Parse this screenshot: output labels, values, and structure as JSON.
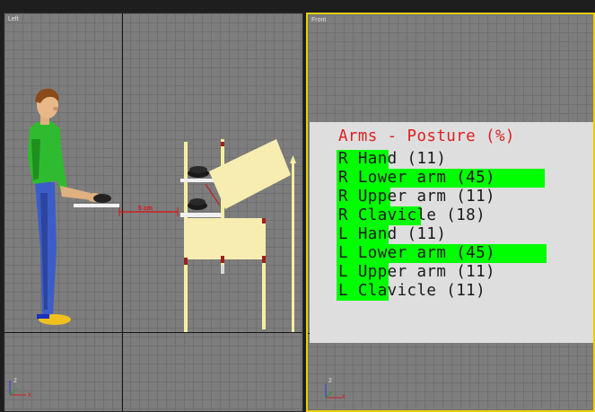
{
  "viewports": {
    "left": {
      "label": "Left"
    },
    "front": {
      "label": "Front"
    }
  },
  "measurement": {
    "label": "5 cm"
  },
  "posture": {
    "title": "Arms - Posture (%)",
    "items": [
      {
        "text": "R Hand (11)",
        "highlight_fraction": 11
      },
      {
        "text": "R Lower arm (45)",
        "highlight_fraction": 45
      },
      {
        "text": "R Upper arm (11)",
        "highlight_fraction": 11
      },
      {
        "text": "R Clavicle (18)",
        "highlight_fraction": 18
      },
      {
        "text": "L Hand (11)",
        "highlight_fraction": 11
      },
      {
        "text": "L Lower arm (45)",
        "highlight_fraction": 45
      },
      {
        "text": "L Upper arm (11)",
        "highlight_fraction": 11
      },
      {
        "text": "L Clavicle (11)",
        "highlight_fraction": 11
      }
    ]
  },
  "gizmo": {
    "z": "z",
    "x": "x"
  },
  "colors": {
    "highlight": "#00ff00",
    "title": "#e02020",
    "active_border": "#e8d000"
  }
}
